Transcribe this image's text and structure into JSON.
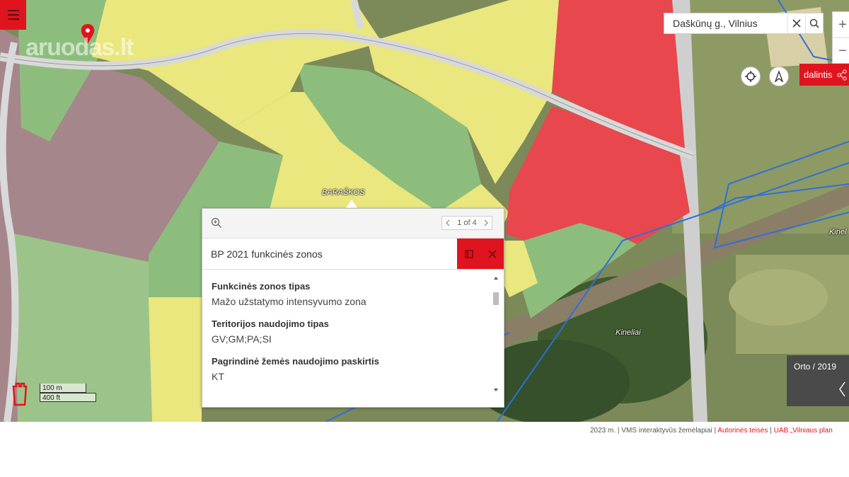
{
  "toolbar": {
    "menu_icon": "hamburger-icon"
  },
  "search": {
    "value": "Daškūnų g., Vilnius",
    "clear_icon": "close-icon",
    "search_icon": "search-icon"
  },
  "zoom": {
    "in": "+",
    "out": "−"
  },
  "tools": {
    "locate_icon": "crosshair-icon",
    "compass_icon": "compass-icon"
  },
  "share": {
    "label": "dalintis",
    "icon": "share-icon"
  },
  "watermark": "aruodas.lt",
  "map_labels": {
    "baraskos": "BARAŠKOS",
    "kineliai": "Kineliai",
    "kinel_edge": "Kinel"
  },
  "popup": {
    "zoom_icon": "magnify-icon",
    "pager": "1 of 4",
    "title": "BP 2021 funkcinės zonos",
    "fields": [
      {
        "label": "Funkcinės zonos tipas",
        "value": "Mažo užstatymo intensyvumo zona"
      },
      {
        "label": "Teritorijos naudojimo tipas",
        "value": "GV;GM;PA;SI"
      },
      {
        "label": "Pagrindinė žemės naudojimo paskirtis",
        "value": "KT"
      }
    ]
  },
  "basemap": {
    "label": "Orto / 2019"
  },
  "scale": {
    "metric": "100 m",
    "imperial": "400 ft"
  },
  "credits": {
    "text": "2023 m. | VMS interaktyvūs žemėlapiai |",
    "link1": "Autorinės teisės",
    "link2": "UAB „Vilniaus plan"
  },
  "colors": {
    "accent": "#e0141e",
    "zone_yellow": "#e9e77d",
    "zone_green": "#8dbd7c",
    "zone_red": "#e8474d",
    "zone_purple": "#a5868b"
  }
}
